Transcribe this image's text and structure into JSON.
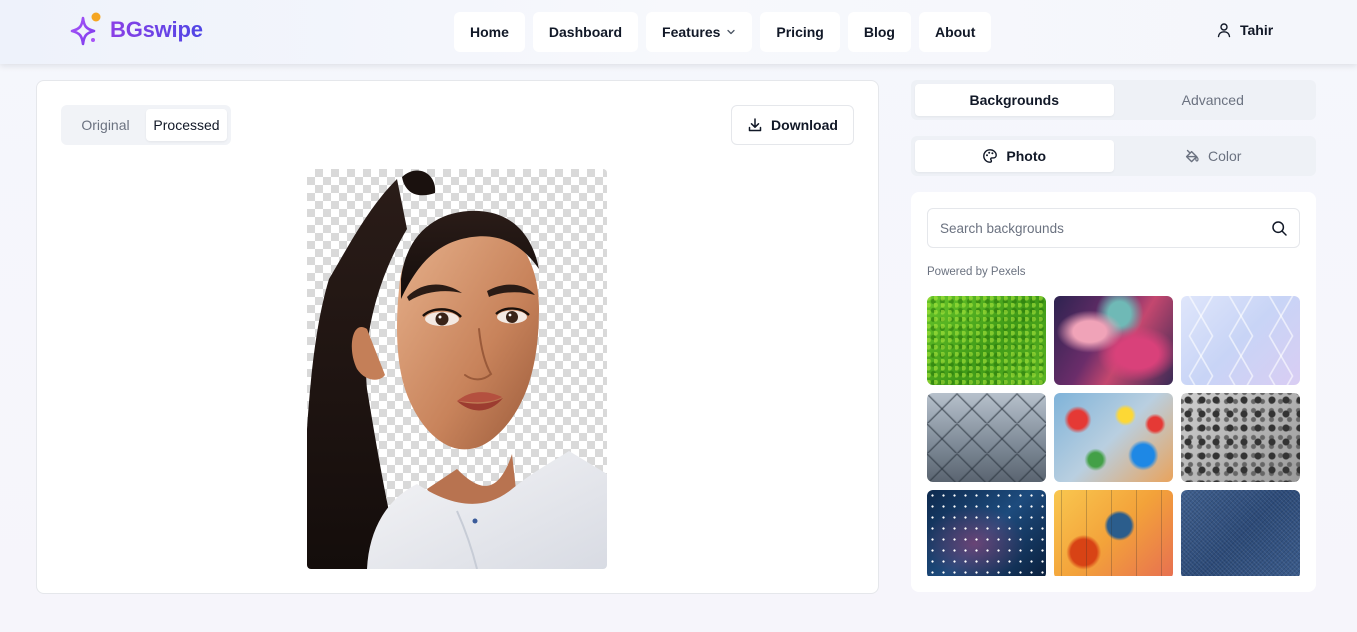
{
  "brand": {
    "name": "BGswipe"
  },
  "nav": {
    "items": [
      {
        "label": "Home"
      },
      {
        "label": "Dashboard"
      },
      {
        "label": "Features",
        "has_dropdown": true
      },
      {
        "label": "Pricing"
      },
      {
        "label": "Blog"
      },
      {
        "label": "About"
      }
    ]
  },
  "user": {
    "name": "Tahir",
    "icon": "user-icon"
  },
  "editor": {
    "view_toggle": {
      "options": [
        "Original",
        "Processed"
      ],
      "selected": "Processed"
    },
    "download_label": "Download",
    "download_icon": "download-icon"
  },
  "panel": {
    "tabs": {
      "options": [
        "Backgrounds",
        "Advanced"
      ],
      "selected": "Backgrounds"
    },
    "source_tabs": {
      "options": [
        {
          "label": "Photo",
          "icon": "palette-icon"
        },
        {
          "label": "Color",
          "icon": "paint-bucket-icon"
        }
      ],
      "selected": "Photo"
    },
    "search": {
      "placeholder": "Search backgrounds",
      "value": "",
      "icon": "search-icon"
    },
    "powered_by": "Powered by Pexels",
    "thumbnails": [
      {
        "kind": "green grass"
      },
      {
        "kind": "colorful swirl"
      },
      {
        "kind": "geometric pastel"
      },
      {
        "kind": "glass diamond grid"
      },
      {
        "kind": "paint splatter"
      },
      {
        "kind": "grey dots"
      },
      {
        "kind": "night sky stars"
      },
      {
        "kind": "abstract painting"
      },
      {
        "kind": "denim texture"
      }
    ]
  },
  "colors": {
    "brand_start": "#8b3fe6",
    "brand_end": "#4f46e5",
    "logo_dot": "#f5a623",
    "text_primary": "#111827",
    "text_muted": "#6b7280"
  }
}
